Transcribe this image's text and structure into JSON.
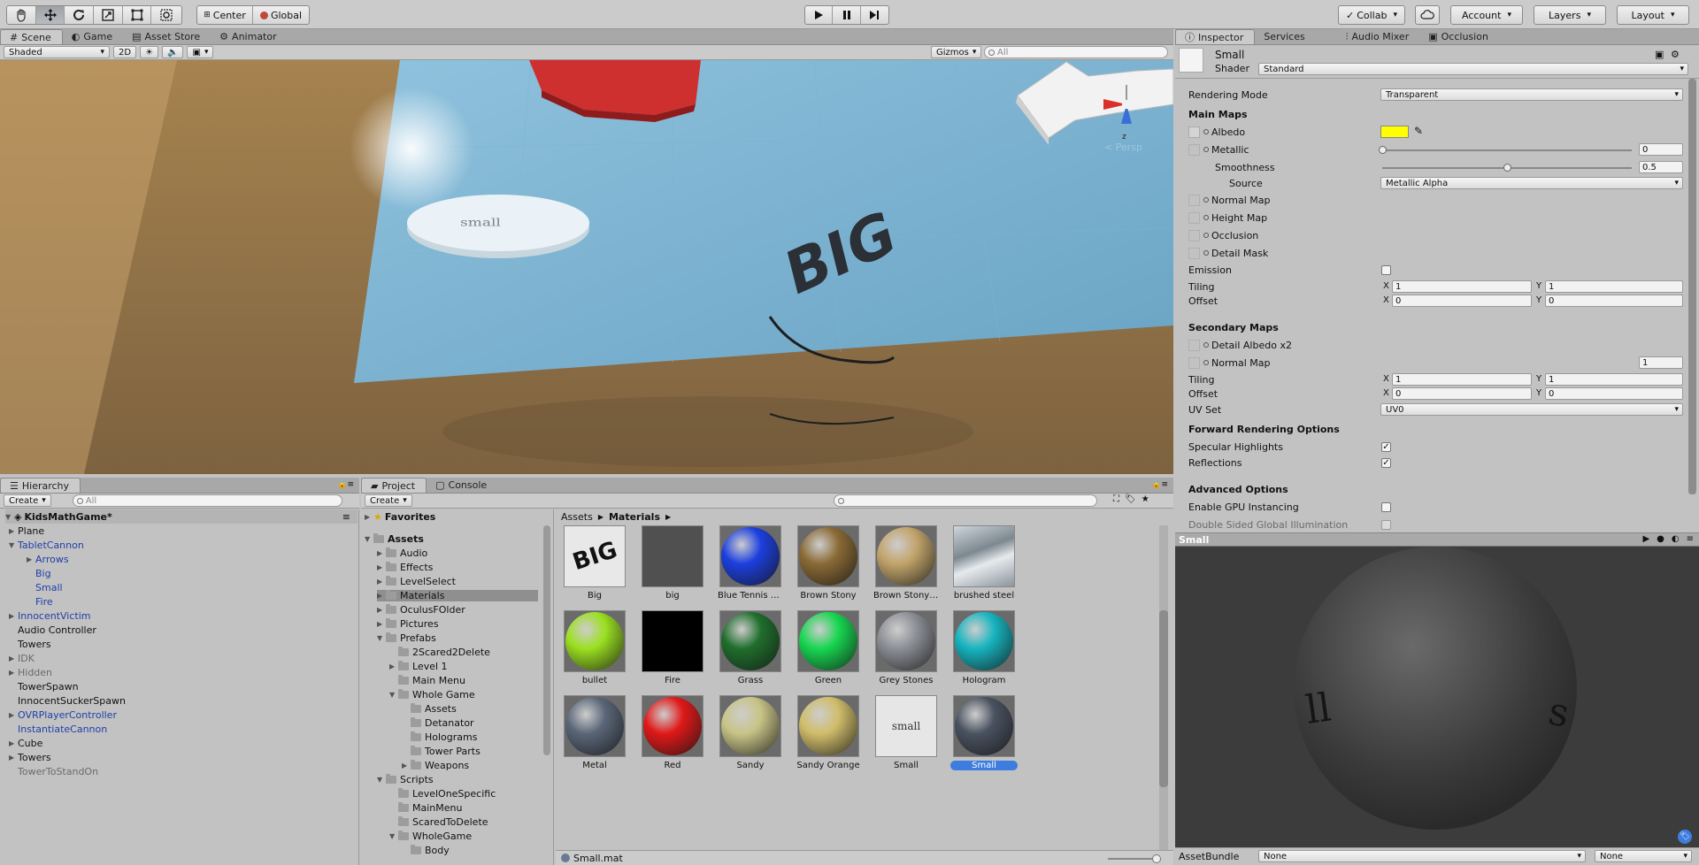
{
  "colors": {
    "selection": "#3e7de0",
    "albedo": "#ffff00",
    "link_blue": "#1e3fa8"
  },
  "toolbar": {
    "tools": [
      "hand-icon",
      "move-icon",
      "rotate-icon",
      "scale-icon",
      "rect-icon",
      "transform-icon"
    ],
    "center_label": "Center",
    "global_label": "Global",
    "collab_label": "Collab",
    "account_label": "Account",
    "layers_label": "Layers",
    "layout_label": "Layout"
  },
  "scene_tabs": {
    "scene": "Scene",
    "game": "Game",
    "asset_store": "Asset Store",
    "animator": "Animator"
  },
  "scene_bar": {
    "shading": "Shaded",
    "mode_2d": "2D",
    "gizmos": "Gizmos",
    "search_placeholder": "All"
  },
  "scene": {
    "persp_label": "Persp",
    "small_text": "small",
    "big_text": "BIG",
    "axis_z": "z"
  },
  "hierarchy": {
    "tab": "Hierarchy",
    "create": "Create",
    "search_placeholder": "All",
    "scene_name": "KidsMathGame*",
    "items": [
      {
        "label": "Plane",
        "indent": 0,
        "arrow": "right",
        "color": "normal"
      },
      {
        "label": "TabletCannon",
        "indent": 0,
        "arrow": "down",
        "color": "blue"
      },
      {
        "label": "Arrows",
        "indent": 1,
        "arrow": "right",
        "color": "blue"
      },
      {
        "label": "Big",
        "indent": 1,
        "arrow": "",
        "color": "blue"
      },
      {
        "label": "Small",
        "indent": 1,
        "arrow": "",
        "color": "blue"
      },
      {
        "label": "Fire",
        "indent": 1,
        "arrow": "",
        "color": "blue"
      },
      {
        "label": "InnocentVictim",
        "indent": 0,
        "arrow": "right",
        "color": "blue"
      },
      {
        "label": "Audio Controller",
        "indent": 0,
        "arrow": "",
        "color": "normal"
      },
      {
        "label": "Towers",
        "indent": 0,
        "arrow": "",
        "color": "normal"
      },
      {
        "label": "IDK",
        "indent": 0,
        "arrow": "right",
        "color": "grey"
      },
      {
        "label": "Hidden",
        "indent": 0,
        "arrow": "right",
        "color": "grey"
      },
      {
        "label": "TowerSpawn",
        "indent": 0,
        "arrow": "",
        "color": "normal"
      },
      {
        "label": "InnocentSuckerSpawn",
        "indent": 0,
        "arrow": "",
        "color": "normal"
      },
      {
        "label": "OVRPlayerController",
        "indent": 0,
        "arrow": "right",
        "color": "blue"
      },
      {
        "label": "InstantiateCannon",
        "indent": 0,
        "arrow": "",
        "color": "blue"
      },
      {
        "label": "Cube",
        "indent": 0,
        "arrow": "right",
        "color": "normal"
      },
      {
        "label": "Towers",
        "indent": 0,
        "arrow": "right",
        "color": "normal"
      },
      {
        "label": "TowerToStandOn",
        "indent": 0,
        "arrow": "",
        "color": "grey"
      }
    ]
  },
  "project": {
    "tab": "Project",
    "console_tab": "Console",
    "create": "Create",
    "breadcrumb": [
      "Assets",
      "Materials"
    ],
    "favorites": "Favorites",
    "tree": [
      {
        "label": "Assets",
        "indent": 0,
        "arrow": "down",
        "bold": true
      },
      {
        "label": "Audio",
        "indent": 1,
        "arrow": "right"
      },
      {
        "label": "Effects",
        "indent": 1,
        "arrow": "right"
      },
      {
        "label": "LevelSelect",
        "indent": 1,
        "arrow": "right"
      },
      {
        "label": "Materials",
        "indent": 1,
        "arrow": "right",
        "selected": true
      },
      {
        "label": "OculusFOlder",
        "indent": 1,
        "arrow": "right"
      },
      {
        "label": "Pictures",
        "indent": 1,
        "arrow": "right"
      },
      {
        "label": "Prefabs",
        "indent": 1,
        "arrow": "down"
      },
      {
        "label": "2Scared2Delete",
        "indent": 2,
        "arrow": ""
      },
      {
        "label": "Level 1",
        "indent": 2,
        "arrow": "right"
      },
      {
        "label": "Main Menu",
        "indent": 2,
        "arrow": ""
      },
      {
        "label": "Whole Game",
        "indent": 2,
        "arrow": "down"
      },
      {
        "label": "Assets",
        "indent": 3,
        "arrow": ""
      },
      {
        "label": "Detanator",
        "indent": 3,
        "arrow": ""
      },
      {
        "label": "Holograms",
        "indent": 3,
        "arrow": ""
      },
      {
        "label": "Tower Parts",
        "indent": 3,
        "arrow": ""
      },
      {
        "label": "Weapons",
        "indent": 3,
        "arrow": "right"
      },
      {
        "label": "Scripts",
        "indent": 1,
        "arrow": "down"
      },
      {
        "label": "LevelOneSpecific",
        "indent": 2,
        "arrow": ""
      },
      {
        "label": "MainMenu",
        "indent": 2,
        "arrow": ""
      },
      {
        "label": "ScaredToDelete",
        "indent": 2,
        "arrow": ""
      },
      {
        "label": "WholeGame",
        "indent": 2,
        "arrow": "down"
      },
      {
        "label": "Body",
        "indent": 3,
        "arrow": ""
      }
    ],
    "assets": [
      {
        "label": "Big",
        "kind": "tex-big"
      },
      {
        "label": "big",
        "kind": "tex-bigdark"
      },
      {
        "label": "Blue Tennis Cou...",
        "kind": "sphere",
        "color": "#1c3fe0"
      },
      {
        "label": "Brown Stony",
        "kind": "sphere",
        "color": "#8a6a35"
      },
      {
        "label": "Brown Stony Lig...",
        "kind": "sphere",
        "color": "#c2a46a"
      },
      {
        "label": "brushed steel",
        "kind": "tex-steel"
      },
      {
        "label": "bullet",
        "kind": "sphere",
        "color": "#9be020"
      },
      {
        "label": "Fire",
        "kind": "tex-black"
      },
      {
        "label": "Grass",
        "kind": "sphere",
        "color": "#1f6e2c"
      },
      {
        "label": "Green",
        "kind": "sphere",
        "color": "#17d650"
      },
      {
        "label": "Grey Stones",
        "kind": "sphere",
        "color": "#8c8f96"
      },
      {
        "label": "Hologram",
        "kind": "sphere",
        "color": "#16b4bf"
      },
      {
        "label": "Metal",
        "kind": "sphere",
        "color": "#5a6678"
      },
      {
        "label": "Red",
        "kind": "sphere",
        "color": "#e01818"
      },
      {
        "label": "Sandy",
        "kind": "sphere",
        "color": "#c8c486"
      },
      {
        "label": "Sandy Orange",
        "kind": "sphere",
        "color": "#d0bd6a"
      },
      {
        "label": "Small",
        "kind": "tex-small",
        "tex_text": "small"
      },
      {
        "label": "Small",
        "kind": "sphere",
        "color": "#4a5260",
        "selected": true
      }
    ],
    "status_file": "Small.mat"
  },
  "inspector": {
    "tab": "Inspector",
    "services_tab": "Services",
    "audio_mixer_tab": "Audio Mixer",
    "occlusion_tab": "Occlusion",
    "material_name": "Small",
    "shader_label": "Shader",
    "shader_value": "Standard",
    "rendering_mode_label": "Rendering Mode",
    "rendering_mode_value": "Transparent",
    "main_maps": "Main Maps",
    "albedo": "Albedo",
    "metallic": "Metallic",
    "metallic_value": "0",
    "metallic_level": 0,
    "smoothness_level": 0.5,
    "smoothness": "Smoothness",
    "smoothness_value": "0.5",
    "source": "Source",
    "source_value": "Metallic Alpha",
    "normal_map": "Normal Map",
    "height_map": "Height Map",
    "occlusion": "Occlusion",
    "detail_mask": "Detail Mask",
    "emission": "Emission",
    "tiling": "Tiling",
    "offset": "Offset",
    "tiling1": {
      "x": "1",
      "y": "1"
    },
    "offset1": {
      "x": "0",
      "y": "0"
    },
    "secondary_maps": "Secondary Maps",
    "detail_albedo": "Detail Albedo x2",
    "normal_map2": "Normal Map",
    "normal_map2_value": "1",
    "tiling2": {
      "x": "1",
      "y": "1"
    },
    "offset2": {
      "x": "0",
      "y": "0"
    },
    "uv_set": "UV Set",
    "uv_set_value": "UV0",
    "forward_rendering": "Forward Rendering Options",
    "specular_highlights": "Specular Highlights",
    "reflections": "Reflections",
    "advanced_options": "Advanced Options",
    "gpu_instancing": "Enable GPU Instancing",
    "double_sided_gi": "Double Sided Global Illumination",
    "x": "X",
    "y": "Y"
  },
  "preview": {
    "title": "Small",
    "assetbundle_label": "AssetBundle",
    "assetbundle_value": "None",
    "variant_value": "None"
  }
}
